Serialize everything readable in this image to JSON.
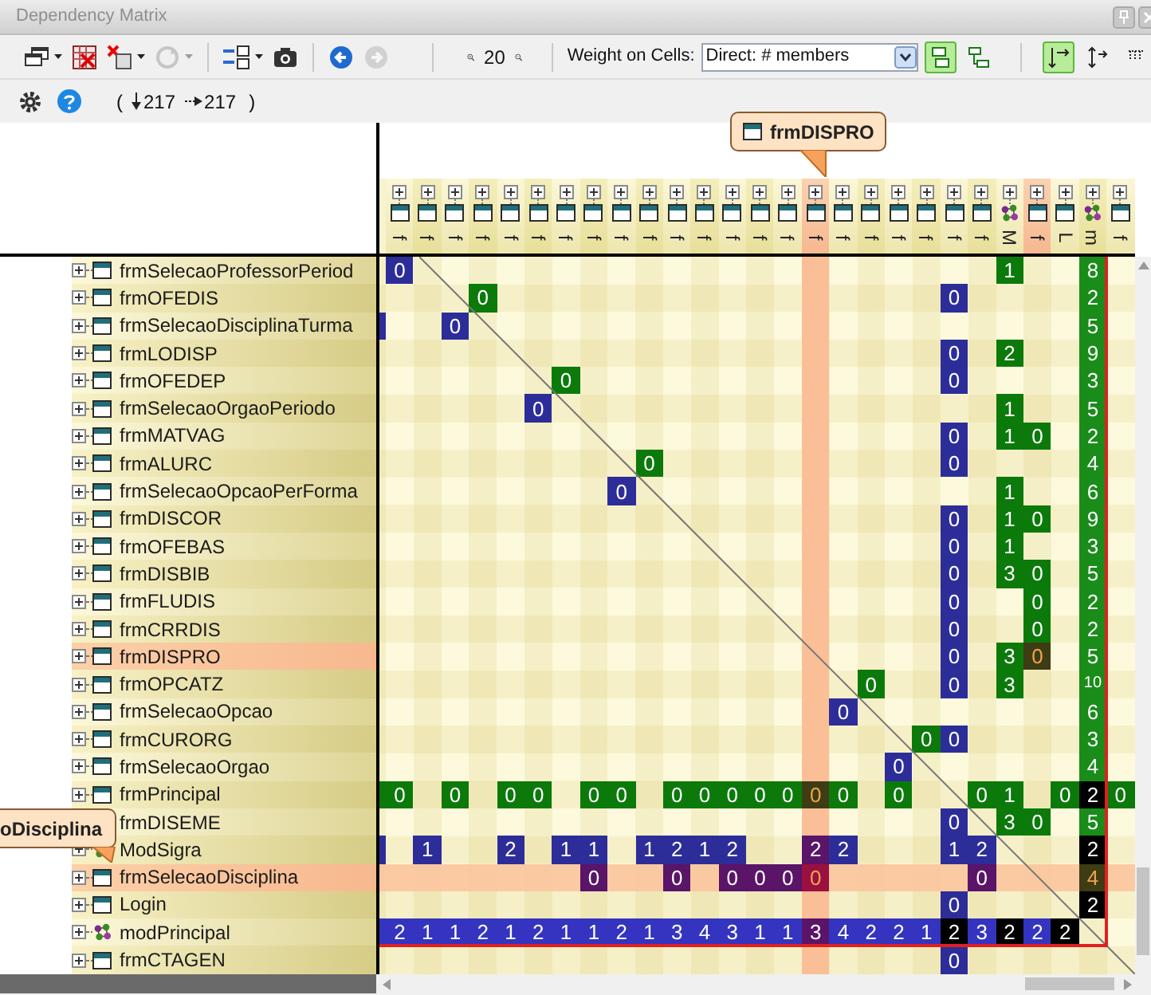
{
  "window": {
    "title": "Dependency Matrix"
  },
  "toolbar": {
    "buttons": [
      {
        "disabled": false,
        "dropdown": true
      },
      {
        "disabled": false,
        "dropdown": false
      },
      {
        "disabled": false,
        "dropdown": true
      },
      {
        "disabled": true,
        "dropdown": true
      },
      {
        "disabled": false,
        "dropdown": true
      },
      {
        "disabled": false,
        "dropdown": false
      },
      {
        "disabled": false,
        "dropdown": false
      },
      {
        "disabled": true,
        "dropdown": false
      }
    ],
    "zoom_level": "20",
    "weight_label": "Weight on Cells:",
    "weight_value": "Direct: # members",
    "toggles": [
      {
        "selected": true
      },
      {
        "selected": false
      },
      {
        "selected": true
      },
      {
        "selected": false
      },
      {
        "selected": false
      }
    ]
  },
  "info_bar": {
    "open_paren": "(",
    "counts": [
      "217",
      "217"
    ],
    "close_paren": ")"
  },
  "column_tooltip": "frmDISPRO",
  "row_tooltip": "oDisciplina",
  "matrix": {
    "columns": [
      {
        "kind": "form",
        "label": "f",
        "header_highlighted": false,
        "column_highlighted": false
      },
      {
        "kind": "form",
        "label": "f",
        "header_highlighted": false,
        "column_highlighted": false
      },
      {
        "kind": "form",
        "label": "f",
        "header_highlighted": false,
        "column_highlighted": false
      },
      {
        "kind": "form",
        "label": "f",
        "header_highlighted": false,
        "column_highlighted": false
      },
      {
        "kind": "form",
        "label": "f",
        "header_highlighted": false,
        "column_highlighted": false
      },
      {
        "kind": "form",
        "label": "f",
        "header_highlighted": false,
        "column_highlighted": false
      },
      {
        "kind": "form",
        "label": "f",
        "header_highlighted": false,
        "column_highlighted": false
      },
      {
        "kind": "form",
        "label": "f",
        "header_highlighted": false,
        "column_highlighted": false
      },
      {
        "kind": "form",
        "label": "f",
        "header_highlighted": false,
        "column_highlighted": false
      },
      {
        "kind": "form",
        "label": "f",
        "header_highlighted": false,
        "column_highlighted": false
      },
      {
        "kind": "form",
        "label": "f",
        "header_highlighted": false,
        "column_highlighted": false
      },
      {
        "kind": "form",
        "label": "f",
        "header_highlighted": false,
        "column_highlighted": false
      },
      {
        "kind": "form",
        "label": "f",
        "header_highlighted": false,
        "column_highlighted": false
      },
      {
        "kind": "form",
        "label": "f",
        "header_highlighted": false,
        "column_highlighted": false
      },
      {
        "kind": "form",
        "label": "f",
        "header_highlighted": false,
        "column_highlighted": false
      },
      {
        "kind": "form",
        "label": "f",
        "header_highlighted": true,
        "column_highlighted": true
      },
      {
        "kind": "form",
        "label": "f",
        "header_highlighted": false,
        "column_highlighted": false
      },
      {
        "kind": "form",
        "label": "f",
        "header_highlighted": false,
        "column_highlighted": false
      },
      {
        "kind": "form",
        "label": "f",
        "header_highlighted": false,
        "column_highlighted": false
      },
      {
        "kind": "form",
        "label": "f",
        "header_highlighted": false,
        "column_highlighted": false
      },
      {
        "kind": "form",
        "label": "f",
        "header_highlighted": false,
        "column_highlighted": false
      },
      {
        "kind": "form",
        "label": "f",
        "header_highlighted": false,
        "column_highlighted": false
      },
      {
        "kind": "module",
        "label": "M",
        "header_highlighted": false,
        "column_highlighted": false
      },
      {
        "kind": "form",
        "label": "f",
        "header_highlighted": true,
        "column_highlighted": false
      },
      {
        "kind": "form",
        "label": "L",
        "header_highlighted": false,
        "column_highlighted": false
      },
      {
        "kind": "module",
        "label": "m",
        "header_highlighted": false,
        "column_highlighted": false
      },
      {
        "kind": "form",
        "label": "f",
        "header_highlighted": false,
        "column_highlighted": false
      }
    ],
    "rows": [
      {
        "label": "frmSelecaoProfessorPeriod",
        "kind": "form",
        "label_highlighted": false,
        "row_highlighted": false,
        "cells": [
          {
            "value": "0",
            "color": "#2d2d9a"
          },
          null,
          null,
          null,
          null,
          null,
          null,
          null,
          null,
          null,
          null,
          null,
          null,
          null,
          null,
          null,
          null,
          null,
          null,
          null,
          null,
          null,
          {
            "value": "1",
            "color": "#0b7a0b"
          },
          null,
          null,
          {
            "value": "8",
            "color": "#1a8c1a"
          },
          null
        ]
      },
      {
        "label": "frmOFEDIS",
        "kind": "form",
        "label_highlighted": false,
        "row_highlighted": false,
        "cells": [
          null,
          null,
          null,
          {
            "value": "0",
            "color": "#0b7a0b"
          },
          null,
          null,
          null,
          null,
          null,
          null,
          null,
          null,
          null,
          null,
          null,
          null,
          null,
          null,
          null,
          null,
          {
            "value": "0",
            "color": "#2d2d9a"
          },
          null,
          null,
          null,
          null,
          {
            "value": "2",
            "color": "#1a8c1a"
          },
          null
        ]
      },
      {
        "label": "frmSelecaoDisciplinaTurma",
        "kind": "form",
        "label_highlighted": false,
        "row_highlighted": false,
        "edge": {
          "color": "#2d2d9a"
        },
        "cells": [
          null,
          null,
          {
            "value": "0",
            "color": "#2d2d9a"
          },
          null,
          null,
          null,
          null,
          null,
          null,
          null,
          null,
          null,
          null,
          null,
          null,
          null,
          null,
          null,
          null,
          null,
          null,
          null,
          null,
          null,
          null,
          {
            "value": "5",
            "color": "#1a8c1a"
          },
          null
        ]
      },
      {
        "label": "frmLODISP",
        "kind": "form",
        "label_highlighted": false,
        "row_highlighted": false,
        "cells": [
          null,
          null,
          null,
          null,
          null,
          null,
          null,
          null,
          null,
          null,
          null,
          null,
          null,
          null,
          null,
          null,
          null,
          null,
          null,
          null,
          {
            "value": "0",
            "color": "#2d2d9a"
          },
          null,
          {
            "value": "2",
            "color": "#0b7a0b"
          },
          null,
          null,
          {
            "value": "9",
            "color": "#1a8c1a"
          },
          null
        ]
      },
      {
        "label": "frmOFEDEP",
        "kind": "form",
        "label_highlighted": false,
        "row_highlighted": false,
        "cells": [
          null,
          null,
          null,
          null,
          null,
          null,
          {
            "value": "0",
            "color": "#0b7a0b"
          },
          null,
          null,
          null,
          null,
          null,
          null,
          null,
          null,
          null,
          null,
          null,
          null,
          null,
          {
            "value": "0",
            "color": "#2d2d9a"
          },
          null,
          null,
          null,
          null,
          {
            "value": "3",
            "color": "#1a8c1a"
          },
          null
        ]
      },
      {
        "label": "frmSelecaoOrgaoPeriodo",
        "kind": "form",
        "label_highlighted": false,
        "row_highlighted": false,
        "cells": [
          null,
          null,
          null,
          null,
          null,
          {
            "value": "0",
            "color": "#2d2d9a"
          },
          null,
          null,
          null,
          null,
          null,
          null,
          null,
          null,
          null,
          null,
          null,
          null,
          null,
          null,
          null,
          null,
          {
            "value": "1",
            "color": "#0b7a0b"
          },
          null,
          null,
          {
            "value": "5",
            "color": "#1a8c1a"
          },
          null
        ]
      },
      {
        "label": "frmMATVAG",
        "kind": "form",
        "label_highlighted": false,
        "row_highlighted": false,
        "cells": [
          null,
          null,
          null,
          null,
          null,
          null,
          null,
          null,
          null,
          null,
          null,
          null,
          null,
          null,
          null,
          null,
          null,
          null,
          null,
          null,
          {
            "value": "0",
            "color": "#2d2d9a"
          },
          null,
          {
            "value": "1",
            "color": "#0b7a0b"
          },
          {
            "value": "0",
            "color": "#0b7a0b"
          },
          null,
          {
            "value": "2",
            "color": "#1a8c1a"
          },
          null
        ]
      },
      {
        "label": "frmALURC",
        "kind": "form",
        "label_highlighted": false,
        "row_highlighted": false,
        "cells": [
          null,
          null,
          null,
          null,
          null,
          null,
          null,
          null,
          null,
          {
            "value": "0",
            "color": "#0b7a0b"
          },
          null,
          null,
          null,
          null,
          null,
          null,
          null,
          null,
          null,
          null,
          {
            "value": "0",
            "color": "#2d2d9a"
          },
          null,
          null,
          null,
          null,
          {
            "value": "4",
            "color": "#1a8c1a"
          },
          null
        ]
      },
      {
        "label": "frmSelecaoOpcaoPerForma",
        "kind": "form",
        "label_highlighted": false,
        "row_highlighted": false,
        "cells": [
          null,
          null,
          null,
          null,
          null,
          null,
          null,
          null,
          {
            "value": "0",
            "color": "#2d2d9a"
          },
          null,
          null,
          null,
          null,
          null,
          null,
          null,
          null,
          null,
          null,
          null,
          null,
          null,
          {
            "value": "1",
            "color": "#0b7a0b"
          },
          null,
          null,
          {
            "value": "6",
            "color": "#1a8c1a"
          },
          null
        ]
      },
      {
        "label": "frmDISCOR",
        "kind": "form",
        "label_highlighted": false,
        "row_highlighted": false,
        "cells": [
          null,
          null,
          null,
          null,
          null,
          null,
          null,
          null,
          null,
          null,
          null,
          null,
          null,
          null,
          null,
          null,
          null,
          null,
          null,
          null,
          {
            "value": "0",
            "color": "#2d2d9a"
          },
          null,
          {
            "value": "1",
            "color": "#0b7a0b"
          },
          {
            "value": "0",
            "color": "#0b7a0b"
          },
          null,
          {
            "value": "9",
            "color": "#1a8c1a"
          },
          null
        ]
      },
      {
        "label": "frmOFEBAS",
        "kind": "form",
        "label_highlighted": false,
        "row_highlighted": false,
        "cells": [
          null,
          null,
          null,
          null,
          null,
          null,
          null,
          null,
          null,
          null,
          null,
          null,
          null,
          null,
          null,
          null,
          null,
          null,
          null,
          null,
          {
            "value": "0",
            "color": "#2d2d9a"
          },
          null,
          {
            "value": "1",
            "color": "#0b7a0b"
          },
          null,
          null,
          {
            "value": "3",
            "color": "#1a8c1a"
          },
          null
        ]
      },
      {
        "label": "frmDISBIB",
        "kind": "form",
        "label_highlighted": false,
        "row_highlighted": false,
        "cells": [
          null,
          null,
          null,
          null,
          null,
          null,
          null,
          null,
          null,
          null,
          null,
          null,
          null,
          null,
          null,
          null,
          null,
          null,
          null,
          null,
          {
            "value": "0",
            "color": "#2d2d9a"
          },
          null,
          {
            "value": "3",
            "color": "#0b7a0b"
          },
          {
            "value": "0",
            "color": "#0b7a0b"
          },
          null,
          {
            "value": "5",
            "color": "#1a8c1a"
          },
          null
        ]
      },
      {
        "label": "frmFLUDIS",
        "kind": "form",
        "label_highlighted": false,
        "row_highlighted": false,
        "cells": [
          null,
          null,
          null,
          null,
          null,
          null,
          null,
          null,
          null,
          null,
          null,
          null,
          null,
          null,
          null,
          null,
          null,
          null,
          null,
          null,
          {
            "value": "0",
            "color": "#2d2d9a"
          },
          null,
          null,
          {
            "value": "0",
            "color": "#0b7a0b"
          },
          null,
          {
            "value": "2",
            "color": "#1a8c1a"
          },
          null
        ]
      },
      {
        "label": "frmCRRDIS",
        "kind": "form",
        "label_highlighted": false,
        "row_highlighted": false,
        "cells": [
          null,
          null,
          null,
          null,
          null,
          null,
          null,
          null,
          null,
          null,
          null,
          null,
          null,
          null,
          null,
          null,
          null,
          null,
          null,
          null,
          {
            "value": "0",
            "color": "#2d2d9a"
          },
          null,
          null,
          {
            "value": "0",
            "color": "#0b7a0b"
          },
          null,
          {
            "value": "2",
            "color": "#1a8c1a"
          },
          null
        ]
      },
      {
        "label": "frmDISPRO",
        "kind": "form",
        "label_highlighted": true,
        "row_highlighted": false,
        "cells": [
          null,
          null,
          null,
          null,
          null,
          null,
          null,
          null,
          null,
          null,
          null,
          null,
          null,
          null,
          null,
          null,
          null,
          null,
          null,
          null,
          {
            "value": "0",
            "color": "#2d2d9a"
          },
          null,
          {
            "value": "3",
            "color": "#0b7a0b"
          },
          {
            "value": "0",
            "color": "#3e3c14",
            "accent": true
          },
          null,
          {
            "value": "5",
            "color": "#1a8c1a"
          },
          null
        ]
      },
      {
        "label": "frmOPCATZ",
        "kind": "form",
        "label_highlighted": false,
        "row_highlighted": false,
        "cells": [
          null,
          null,
          null,
          null,
          null,
          null,
          null,
          null,
          null,
          null,
          null,
          null,
          null,
          null,
          null,
          null,
          null,
          {
            "value": "0",
            "color": "#0b7a0b"
          },
          null,
          null,
          {
            "value": "0",
            "color": "#2d2d9a"
          },
          null,
          {
            "value": "3",
            "color": "#0b7a0b"
          },
          null,
          null,
          {
            "value": "10",
            "color": "#1a8c1a"
          },
          null
        ]
      },
      {
        "label": "frmSelecaoOpcao",
        "kind": "form",
        "label_highlighted": false,
        "row_highlighted": false,
        "cells": [
          null,
          null,
          null,
          null,
          null,
          null,
          null,
          null,
          null,
          null,
          null,
          null,
          null,
          null,
          null,
          null,
          {
            "value": "0",
            "color": "#2d2d9a"
          },
          null,
          null,
          null,
          null,
          null,
          null,
          null,
          null,
          {
            "value": "6",
            "color": "#1a8c1a"
          },
          null
        ]
      },
      {
        "label": "frmCURORG",
        "kind": "form",
        "label_highlighted": false,
        "row_highlighted": false,
        "cells": [
          null,
          null,
          null,
          null,
          null,
          null,
          null,
          null,
          null,
          null,
          null,
          null,
          null,
          null,
          null,
          null,
          null,
          null,
          null,
          {
            "value": "0",
            "color": "#0b7a0b"
          },
          {
            "value": "0",
            "color": "#2d2d9a"
          },
          null,
          null,
          null,
          null,
          {
            "value": "3",
            "color": "#1a8c1a"
          },
          null
        ]
      },
      {
        "label": "frmSelecaoOrgao",
        "kind": "form",
        "label_highlighted": false,
        "row_highlighted": false,
        "cells": [
          null,
          null,
          null,
          null,
          null,
          null,
          null,
          null,
          null,
          null,
          null,
          null,
          null,
          null,
          null,
          null,
          null,
          null,
          {
            "value": "0",
            "color": "#2d2d9a"
          },
          null,
          null,
          null,
          null,
          null,
          null,
          {
            "value": "4",
            "color": "#1a8c1a"
          },
          null
        ]
      },
      {
        "label": "frmPrincipal",
        "kind": "form",
        "label_highlighted": false,
        "row_highlighted": false,
        "edge": {
          "color": "#0b7a0b"
        },
        "cells": [
          {
            "value": "0",
            "color": "#0b7a0b"
          },
          null,
          {
            "value": "0",
            "color": "#0b7a0b"
          },
          null,
          {
            "value": "0",
            "color": "#0b7a0b"
          },
          {
            "value": "0",
            "color": "#0b7a0b"
          },
          null,
          {
            "value": "0",
            "color": "#0b7a0b"
          },
          {
            "value": "0",
            "color": "#0b7a0b"
          },
          null,
          {
            "value": "0",
            "color": "#0b7a0b"
          },
          {
            "value": "0",
            "color": "#0b7a0b"
          },
          {
            "value": "0",
            "color": "#0b7a0b"
          },
          {
            "value": "0",
            "color": "#0b7a0b"
          },
          {
            "value": "0",
            "color": "#0b7a0b"
          },
          {
            "value": "0",
            "color": "#3e3c14",
            "accent": true
          },
          {
            "value": "0",
            "color": "#0b7a0b"
          },
          null,
          {
            "value": "0",
            "color": "#0b7a0b"
          },
          null,
          null,
          {
            "value": "0",
            "color": "#0b7a0b"
          },
          {
            "value": "1",
            "color": "#0b7a0b"
          },
          null,
          {
            "value": "0",
            "color": "#0b7a0b"
          },
          {
            "value": "2",
            "color": "#000000"
          },
          {
            "value": "0",
            "color": "#0b7a0b"
          }
        ]
      },
      {
        "label": "frmDISEME",
        "label_highlighted": false,
        "row_highlighted": false,
        "cells": [
          null,
          null,
          null,
          null,
          null,
          null,
          null,
          null,
          null,
          null,
          null,
          null,
          null,
          null,
          null,
          null,
          null,
          null,
          null,
          null,
          {
            "value": "0",
            "color": "#2d2d9a"
          },
          null,
          {
            "value": "3",
            "color": "#0b7a0b"
          },
          {
            "value": "0",
            "color": "#0b7a0b"
          },
          null,
          {
            "value": "5",
            "color": "#1a8c1a"
          },
          null
        ]
      },
      {
        "label": "ModSigra",
        "kind": "module",
        "label_highlighted": false,
        "row_highlighted": false,
        "edge": {
          "color": "#2d2d9a"
        },
        "cells": [
          null,
          {
            "value": "1",
            "color": "#2d2d9a"
          },
          null,
          null,
          {
            "value": "2",
            "color": "#2d2d9a"
          },
          null,
          {
            "value": "1",
            "color": "#2d2d9a"
          },
          {
            "value": "1",
            "color": "#2d2d9a"
          },
          null,
          {
            "value": "1",
            "color": "#2d2d9a"
          },
          {
            "value": "2",
            "color": "#2d2d9a"
          },
          {
            "value": "1",
            "color": "#2d2d9a"
          },
          {
            "value": "2",
            "color": "#2d2d9a"
          },
          null,
          null,
          {
            "value": "2",
            "color": "#5a1468"
          },
          {
            "value": "2",
            "color": "#2d2d9a"
          },
          null,
          null,
          null,
          {
            "value": "1",
            "color": "#2d2d9a"
          },
          {
            "value": "2",
            "color": "#2d2d9a"
          },
          null,
          null,
          null,
          {
            "value": "2",
            "color": "#000000"
          },
          null
        ]
      },
      {
        "label": "frmSelecaoDisciplina",
        "kind": "form",
        "label_highlighted": true,
        "row_highlighted": true,
        "cells": [
          null,
          null,
          null,
          null,
          null,
          null,
          null,
          {
            "value": "0",
            "color": "#5a1468"
          },
          null,
          null,
          {
            "value": "0",
            "color": "#5a1468"
          },
          null,
          {
            "value": "0",
            "color": "#5a1468"
          },
          {
            "value": "0",
            "color": "#5a1468"
          },
          {
            "value": "0",
            "color": "#5a1468"
          },
          {
            "value": "0",
            "color": "#9a1040",
            "accent": true
          },
          null,
          null,
          null,
          null,
          null,
          {
            "value": "0",
            "color": "#5a1468"
          },
          null,
          null,
          null,
          {
            "value": "4",
            "color": "#3e3c14",
            "accent": true
          },
          null
        ]
      },
      {
        "label": "Login",
        "kind": "form",
        "label_highlighted": false,
        "row_highlighted": false,
        "cells": [
          null,
          null,
          null,
          null,
          null,
          null,
          null,
          null,
          null,
          null,
          null,
          null,
          null,
          null,
          null,
          null,
          null,
          null,
          null,
          null,
          {
            "value": "0",
            "color": "#2d2d9a"
          },
          null,
          null,
          null,
          null,
          {
            "value": "2",
            "color": "#000000"
          },
          null
        ]
      },
      {
        "label": "modPrincipal",
        "kind": "module",
        "label_highlighted": false,
        "row_highlighted": false,
        "edge": {
          "color": "#3434c0"
        },
        "cells": [
          {
            "value": "2",
            "color": "#3434c0"
          },
          {
            "value": "1",
            "color": "#3434c0"
          },
          {
            "value": "1",
            "color": "#3434c0"
          },
          {
            "value": "2",
            "color": "#3434c0"
          },
          {
            "value": "1",
            "color": "#3434c0"
          },
          {
            "value": "2",
            "color": "#3434c0"
          },
          {
            "value": "1",
            "color": "#3434c0"
          },
          {
            "value": "1",
            "color": "#3434c0"
          },
          {
            "value": "2",
            "color": "#3434c0"
          },
          {
            "value": "1",
            "color": "#3434c0"
          },
          {
            "value": "3",
            "color": "#3434c0"
          },
          {
            "value": "4",
            "color": "#3434c0"
          },
          {
            "value": "3",
            "color": "#3434c0"
          },
          {
            "value": "1",
            "color": "#3434c0"
          },
          {
            "value": "1",
            "color": "#3434c0"
          },
          {
            "value": "3",
            "color": "#5a1468"
          },
          {
            "value": "4",
            "color": "#3434c0"
          },
          {
            "value": "2",
            "color": "#3434c0"
          },
          {
            "value": "2",
            "color": "#3434c0"
          },
          {
            "value": "1",
            "color": "#3434c0"
          },
          {
            "value": "2",
            "color": "#000000"
          },
          {
            "value": "3",
            "color": "#3434c0"
          },
          {
            "value": "2",
            "color": "#000000"
          },
          {
            "value": "2",
            "color": "#3434c0"
          },
          {
            "value": "2",
            "color": "#000000"
          },
          null,
          null
        ]
      },
      {
        "label": "frmCTAGEN",
        "kind": "form",
        "label_highlighted": false,
        "row_highlighted": false,
        "cells": [
          null,
          null,
          null,
          null,
          null,
          null,
          null,
          null,
          null,
          null,
          null,
          null,
          null,
          null,
          null,
          null,
          null,
          null,
          null,
          null,
          {
            "value": "0",
            "color": "#2d2d9a"
          },
          null,
          null,
          null,
          null,
          null,
          null
        ]
      }
    ]
  }
}
